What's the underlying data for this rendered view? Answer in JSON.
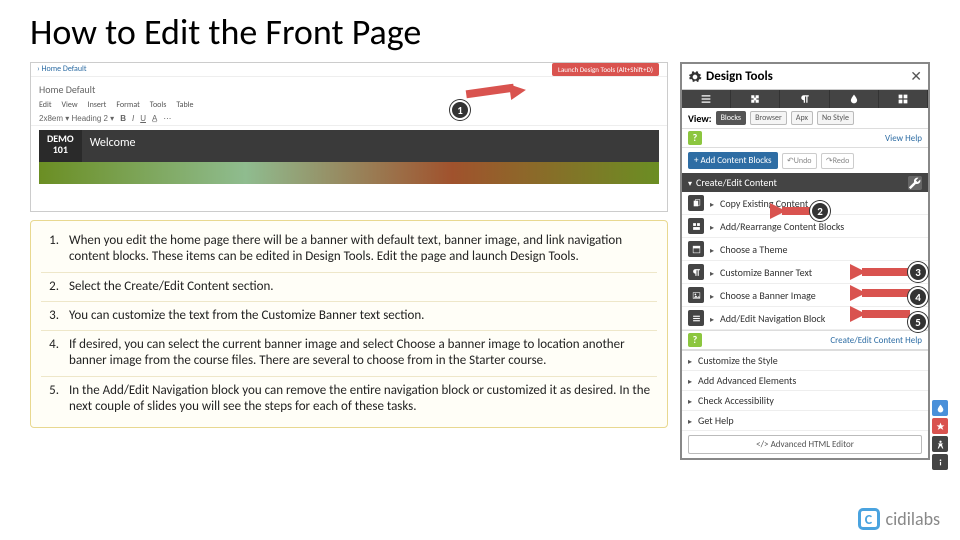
{
  "title": "How to Edit the Front Page",
  "editor": {
    "breadcrumb": "› Home Default",
    "launch_btn": "Launch Design Tools (Alt+Shift+D)",
    "page_title": "Home Default",
    "menu": [
      "Edit",
      "View",
      "Insert",
      "Format",
      "Tools",
      "Table"
    ],
    "toolbar_left": "2x8em ▾   Heading 2 ▾",
    "demo_badge_line1": "DEMO",
    "demo_badge_line2": "101",
    "banner_text": "Welcome"
  },
  "steps": [
    {
      "n": "1.",
      "t": "When you edit the home page there will be a banner with default text, banner image, and link navigation content blocks. These items can be edited in Design Tools. Edit the page and launch Design Tools."
    },
    {
      "n": "2.",
      "t": "Select the Create/Edit Content section."
    },
    {
      "n": "3.",
      "t": "You can customize the text from the Customize Banner text section."
    },
    {
      "n": "4.",
      "t": "If desired, you can select the current banner image and select Choose a banner image to location another banner image from the course files. There are several to choose from in the Starter course."
    },
    {
      "n": "5.",
      "t": "In the Add/Edit Navigation block you can remove the entire navigation block or customized it as desired. In the next couple of slides you will see the steps for each of these tasks."
    }
  ],
  "panel": {
    "title": "Design Tools",
    "view_label": "View:",
    "view_chips": [
      "Blocks",
      "Browser",
      "Apx",
      "No Style"
    ],
    "view_help": "View Help",
    "add_blocks": "+ Add Content Blocks",
    "undo": "↶Undo",
    "redo": "↷Redo",
    "section1": "Create/Edit Content",
    "items1": [
      "Copy Existing Content",
      "Add/Rearrange Content Blocks",
      "Choose a Theme",
      "Customize Banner Text",
      "Choose a Banner Image",
      "Add/Edit Navigation Block"
    ],
    "content_help": "Create/Edit Content Help",
    "items2": [
      "Customize the Style",
      "Add Advanced Elements",
      "Check Accessibility",
      "Get Help"
    ],
    "adv_btn": "</> Advanced HTML Editor"
  },
  "callouts": [
    "1",
    "2",
    "3",
    "4",
    "5"
  ],
  "logo": {
    "c": "C",
    "name": "cidilabs"
  }
}
